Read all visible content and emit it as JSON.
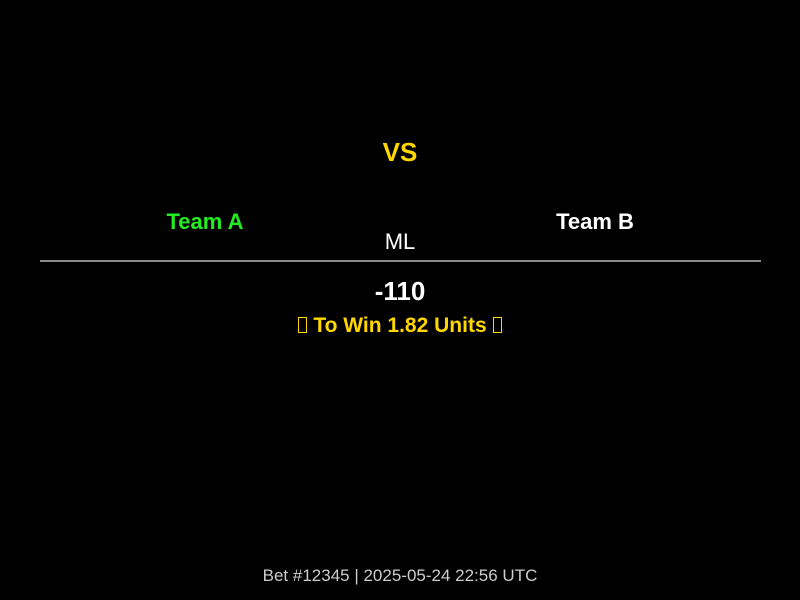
{
  "matchup": {
    "vs_label": "VS",
    "team_a": "Team A",
    "team_b": "Team B",
    "market": "ML"
  },
  "bet": {
    "odds": "-110",
    "to_win_text": "To Win 1.82 Units"
  },
  "footer": {
    "text": "Bet #12345 | 2025-05-24 22:56 UTC"
  },
  "icons": {
    "left": "missing-glyph-icon",
    "right": "missing-glyph-icon"
  },
  "colors": {
    "background": "#000000",
    "accent_gold": "#FFD700",
    "team_a_green": "#22EE22",
    "divider_gray": "#888888"
  }
}
